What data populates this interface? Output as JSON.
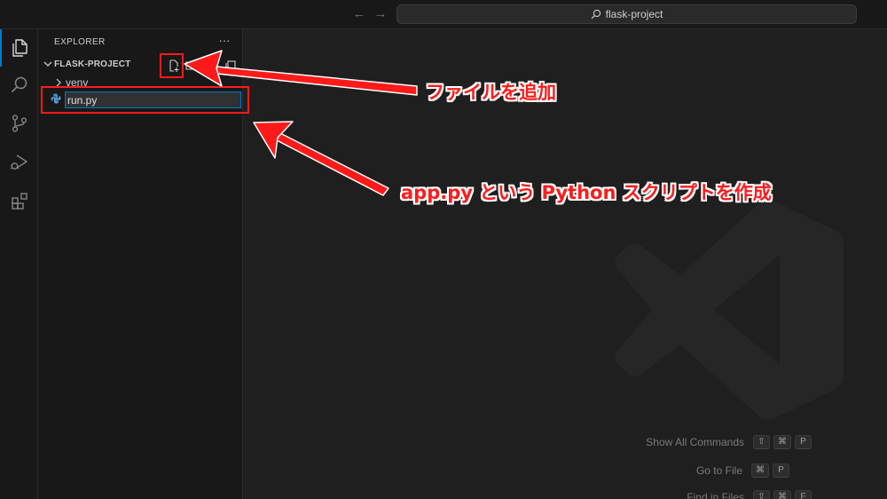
{
  "titlebar": {
    "nav_back_icon": "arrow-left-icon",
    "nav_forward_icon": "arrow-right-icon",
    "search_text": "flask-project"
  },
  "activity_bar": {
    "items": [
      "explorer-icon",
      "search-icon",
      "source-control-icon",
      "run-debug-icon",
      "extensions-icon"
    ],
    "active": "explorer-icon",
    "accent": "#0078d4"
  },
  "sidebar": {
    "title": "EXPLORER",
    "more": "···",
    "section_title": "FLASK-PROJECT",
    "actions": [
      "new-file-icon",
      "new-folder-icon",
      "refresh-icon",
      "collapse-all-icon"
    ],
    "tree": [
      {
        "label": "venv",
        "type": "folder"
      }
    ],
    "rename_input_value": "run.py"
  },
  "editor": {
    "watermark": "vscode-logo-icon",
    "shortcuts": [
      {
        "label": "Show All Commands",
        "keys": [
          "⇧",
          "⌘",
          "P"
        ]
      },
      {
        "label": "Go to File",
        "keys": [
          "⌘",
          "P"
        ]
      },
      {
        "label": "Find in Files",
        "keys": [
          "⇧",
          "⌘",
          "F"
        ]
      }
    ]
  },
  "annotations": {
    "callout_add_file": "ファイルを追加",
    "callout_create_script": "app.py という Python スクリプトを作成",
    "color": "#ff1a1a"
  }
}
